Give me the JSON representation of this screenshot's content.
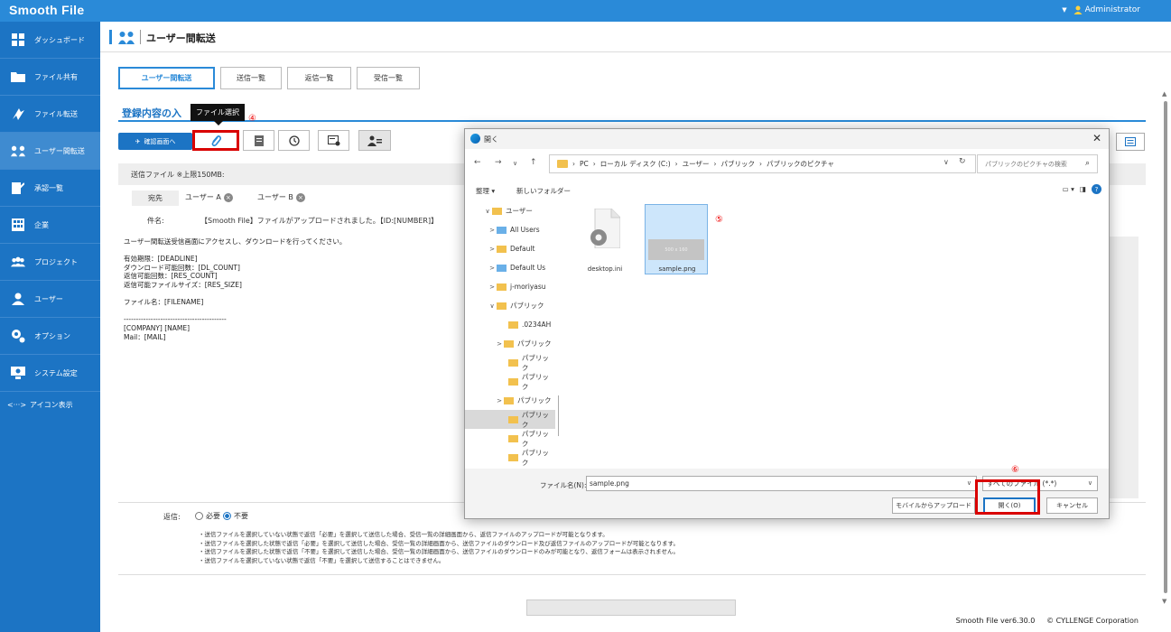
{
  "app": {
    "logo": "Smooth File",
    "user": "Administrator"
  },
  "sidebar": {
    "items": [
      {
        "label": "ダッシュボード",
        "icon": "dashboard-icon"
      },
      {
        "label": "ファイル共有",
        "icon": "folder-icon"
      },
      {
        "label": "ファイル転送",
        "icon": "transfer-icon"
      },
      {
        "label": "ユーザー間転送",
        "icon": "users-transfer-icon",
        "active": true
      },
      {
        "label": "承認一覧",
        "icon": "approval-icon"
      },
      {
        "label": "企業",
        "icon": "building-icon"
      },
      {
        "label": "プロジェクト",
        "icon": "project-icon"
      },
      {
        "label": "ユーザー",
        "icon": "user-icon"
      },
      {
        "label": "オプション",
        "icon": "gears-icon"
      },
      {
        "label": "システム設定",
        "icon": "system-settings-icon"
      }
    ],
    "icon_view": {
      "label": "アイコン表示",
      "icon": "arrows-icon"
    }
  },
  "header": {
    "title": "ユーザー間転送"
  },
  "tabs": [
    "ユーザー間転送",
    "送信一覧",
    "返信一覧",
    "受信一覧"
  ],
  "section": {
    "title": "登録内容の入",
    "tooltip": "ファイル選択"
  },
  "steps": {
    "s4": "④",
    "s5": "⑤",
    "s6": "⑥"
  },
  "toolbar": {
    "confirm": "確認画面へ"
  },
  "form": {
    "send_file_label": "送信ファイル ※上限150MB:",
    "dest_label": "宛先",
    "recipients": [
      "ユーザー A",
      "ユーザー B"
    ],
    "subject_label": "件名:",
    "subject_value": "【Smooth File】ファイルがアップロードされました。【ID:[NUMBER]】",
    "body_lines": [
      "ユーザー間転送受信画面にアクセスし、ダウンロードを行ってください。",
      "",
      "有効期限：[DEADLINE]",
      "ダウンロード可能回数：[DL_COUNT]",
      "返信可能回数：[RES_COUNT]",
      "返信可能ファイルサイズ：[RES_SIZE]",
      "",
      "ファイル名：[FILENAME]",
      "",
      "------------------------------------------",
      "[COMPANY] [NAME]",
      "Mail：[MAIL]"
    ],
    "reply_label": "返信:",
    "reply_required": "必要",
    "reply_not_required": "不要",
    "notes": [
      "・送信ファイルを選択していない状態で返信「必要」を選択して送信した場合、受信一覧の詳細画面から、返信ファイルのアップロードが可能となります。",
      "・送信ファイルを選択した状態で返信「必要」を選択して送信した場合、受信一覧の詳細画面から、送信ファイルのダウンロード及び返信ファイルのアップロードが可能となります。",
      "・送信ファイルを選択した状態で返信「不要」を選択して送信した場合、受信一覧の詳細画面から、送信ファイルのダウンロードのみが可能となり、返信フォームは表示されません。",
      "・送信ファイルを選択していない状態で返信「不要」を選択して送信することはできません。"
    ]
  },
  "footer": {
    "version": "Smooth File ver6.30.0",
    "copyright": "© CYLLENGE Corporation"
  },
  "dialog": {
    "title": "開く",
    "address": [
      "PC",
      "ローカル ディスク (C:)",
      "ユーザー",
      "パブリック",
      "パブリックのピクチャ"
    ],
    "search_placeholder": "パブリックのピクチャの検索",
    "organize": "整理 ▾",
    "new_folder": "新しいフォルダー",
    "tree": [
      {
        "label": "ユーザー",
        "chev": "∨",
        "type": "folder"
      },
      {
        "label": "All Users",
        "chev": ">",
        "type": "user"
      },
      {
        "label": "Default",
        "chev": ">",
        "type": "folder"
      },
      {
        "label": "Default Us",
        "chev": ">",
        "type": "user"
      },
      {
        "label": "j-moriyasu",
        "chev": ">",
        "type": "folder"
      },
      {
        "label": "パブリック",
        "chev": "∨",
        "type": "folder"
      },
      {
        "label": ".0234AH",
        "chev": "",
        "type": "folder"
      },
      {
        "label": "パブリック",
        "chev": ">",
        "type": "folder"
      },
      {
        "label": "パブリック",
        "chev": "",
        "type": "folder"
      },
      {
        "label": "パブリック",
        "chev": "",
        "type": "folder"
      },
      {
        "label": "パブリック",
        "chev": ">",
        "type": "folder"
      },
      {
        "label": "パブリック",
        "chev": "",
        "type": "folder",
        "selected": true
      },
      {
        "label": "パブリック",
        "chev": "",
        "type": "folder"
      },
      {
        "label": "パブリック",
        "chev": "",
        "type": "folder"
      }
    ],
    "files": [
      {
        "name": "desktop.ini"
      },
      {
        "name": "sample.png",
        "thumb": "500 x 160",
        "selected": true
      }
    ],
    "filename_label": "ファイル名(N):",
    "filename_value": "sample.png",
    "filetype": "すべてのファイル (*.*)",
    "mobile_upload": "モバイルからアップロード",
    "open": "開く(O)",
    "cancel": "キャンセル"
  }
}
